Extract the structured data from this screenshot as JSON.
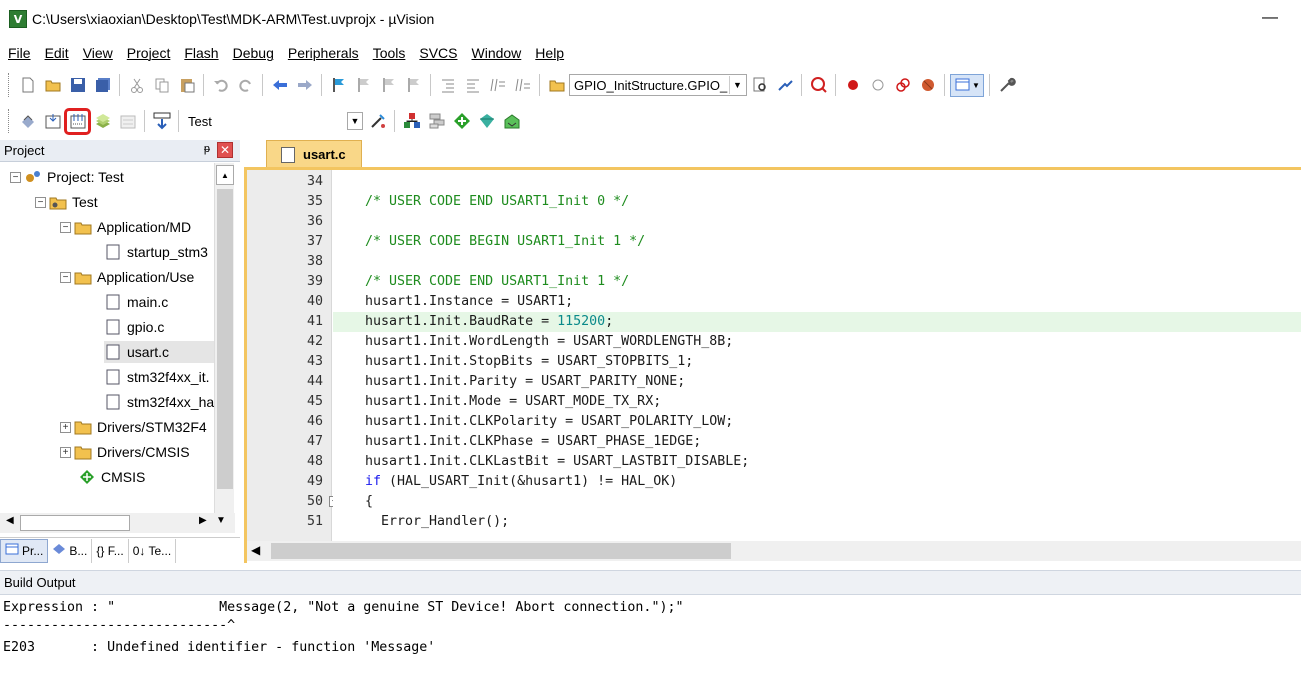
{
  "window": {
    "title": "C:\\Users\\xiaoxian\\Desktop\\Test\\MDK-ARM\\Test.uvprojx - µVision",
    "minimize_glyph": "—"
  },
  "menu": [
    "File",
    "Edit",
    "View",
    "Project",
    "Flash",
    "Debug",
    "Peripherals",
    "Tools",
    "SVCS",
    "Window",
    "Help"
  ],
  "toolbar1": {
    "find_combo_value": "GPIO_InitStructure.GPIO_"
  },
  "toolbar2": {
    "target_combo_value": "Test"
  },
  "project_panel": {
    "title": "Project",
    "pin_glyph": "ᵽ",
    "close_glyph": "✕",
    "tree": [
      {
        "label": "Project: Test",
        "expander": "−"
      },
      {
        "label": "Test",
        "expander": "−"
      },
      {
        "label": "Application/MD",
        "expander": "−"
      },
      {
        "label": "startup_stm3",
        "expander": ""
      },
      {
        "label": "Application/Use",
        "expander": "−"
      },
      {
        "label": "main.c",
        "expander": ""
      },
      {
        "label": "gpio.c",
        "expander": ""
      },
      {
        "label": "usart.c",
        "expander": ""
      },
      {
        "label": "stm32f4xx_it.",
        "expander": ""
      },
      {
        "label": "stm32f4xx_ha",
        "expander": ""
      },
      {
        "label": "Drivers/STM32F4",
        "expander": "+"
      },
      {
        "label": "Drivers/CMSIS",
        "expander": "+"
      },
      {
        "label": "CMSIS",
        "expander": ""
      }
    ],
    "bottom_tabs": [
      "Pr...",
      "B...",
      "{} F...",
      "0↓ Te..."
    ]
  },
  "editor": {
    "active_tab": "usart.c",
    "lines": [
      {
        "num": "34",
        "text": ""
      },
      {
        "num": "35",
        "text": "/* USER CODE END USART1_Init 0 */"
      },
      {
        "num": "36",
        "text": ""
      },
      {
        "num": "37",
        "text": "/* USER CODE BEGIN USART1_Init 1 */"
      },
      {
        "num": "38",
        "text": ""
      },
      {
        "num": "39",
        "text": "/* USER CODE END USART1_Init 1 */"
      },
      {
        "num": "40",
        "text": "husart1.Instance = USART1;"
      },
      {
        "num": "41",
        "text": "husart1.Init.BaudRate = ",
        "num_part": "115200",
        "tail": ";"
      },
      {
        "num": "42",
        "text": "husart1.Init.WordLength = USART_WORDLENGTH_8B;"
      },
      {
        "num": "43",
        "text": "husart1.Init.StopBits = USART_STOPBITS_1;"
      },
      {
        "num": "44",
        "text": "husart1.Init.Parity = USART_PARITY_NONE;"
      },
      {
        "num": "45",
        "text": "husart1.Init.Mode = USART_MODE_TX_RX;"
      },
      {
        "num": "46",
        "text": "husart1.Init.CLKPolarity = USART_POLARITY_LOW;"
      },
      {
        "num": "47",
        "text": "husart1.Init.CLKPhase = USART_PHASE_1EDGE;"
      },
      {
        "num": "48",
        "text": "husart1.Init.CLKLastBit = USART_LASTBIT_DISABLE;"
      },
      {
        "num": "49",
        "kw": "if",
        "text": " (HAL_USART_Init(&husart1) != HAL_OK)"
      },
      {
        "num": "50",
        "text": "{"
      },
      {
        "num": "51",
        "text": "  Error_Handler();"
      }
    ],
    "fold_glyph": "−"
  },
  "build_output": {
    "title": "Build Output",
    "lines": [
      "Expression : \"             Message(2, \"Not a genuine ST Device! Abort connection.\");\"",
      "----------------------------^",
      "E203       : Undefined identifier - function 'Message'"
    ]
  },
  "colors": {
    "comment": "#1e8c1e",
    "keyword": "#1a1aee",
    "number": "#0a8a8a",
    "current_line": "#e6f7e6",
    "tab_active": "#f9d788",
    "highlight_box": "#e02020"
  }
}
